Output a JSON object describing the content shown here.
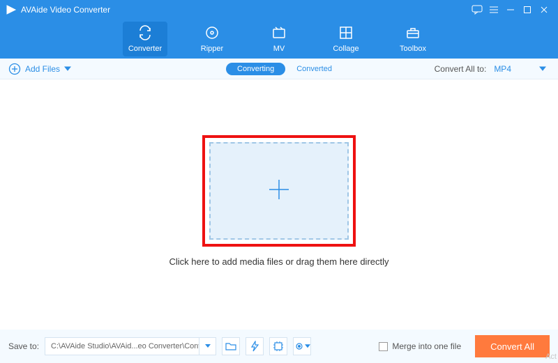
{
  "title": "AVAide Video Converter",
  "nav": {
    "converter": "Converter",
    "ripper": "Ripper",
    "mv": "MV",
    "collage": "Collage",
    "toolbox": "Toolbox"
  },
  "subbar": {
    "add_files": "Add Files",
    "converting": "Converting",
    "converted": "Converted",
    "convert_all_to": "Convert All to:",
    "format": "MP4"
  },
  "main": {
    "drop_msg": "Click here to add media files or drag them here directly"
  },
  "footer": {
    "save_to_label": "Save to:",
    "save_path": "C:\\AVAide Studio\\AVAid...eo Converter\\Converted",
    "merge_label": "Merge into one file",
    "convert_all": "Convert All"
  },
  "watermark": "Act"
}
